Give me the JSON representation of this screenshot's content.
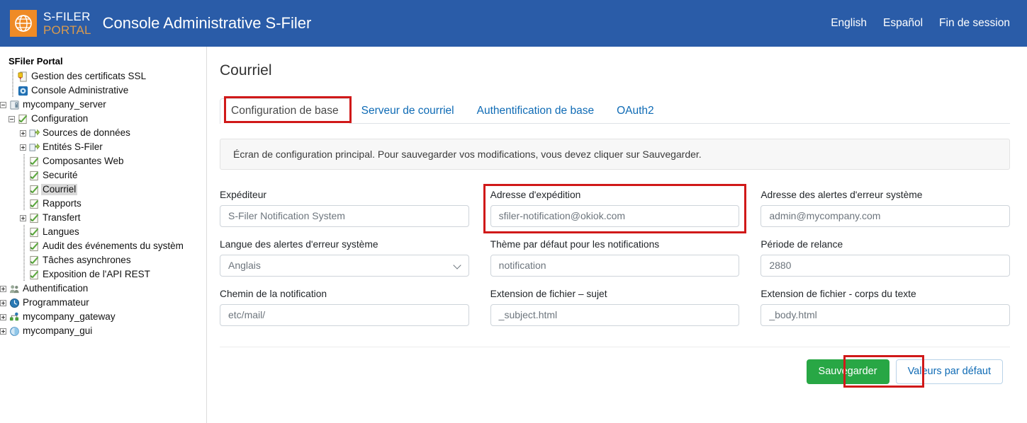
{
  "header": {
    "logo": {
      "icon": "globe-icon",
      "line1": "S-FILER",
      "line2": "PORTAL",
      "square_color": "#ef8b26"
    },
    "app_title": "Console Administrative S-Filer",
    "nav": [
      {
        "label": "English"
      },
      {
        "label": "Español"
      },
      {
        "label": "Fin de session"
      }
    ],
    "background_color": "#2a5ca8"
  },
  "sidebar": {
    "root_label": "SFiler Portal",
    "nodes": [
      {
        "label": "Gestion des certificats SSL",
        "indent": 1,
        "expander": "none",
        "icon": "certificate-icon",
        "selected": false
      },
      {
        "label": "Console Administrative",
        "indent": 1,
        "expander": "none",
        "icon": "gear-icon",
        "selected": false
      },
      {
        "label": "mycompany_server",
        "indent": 0,
        "expander": "minus",
        "icon": "server-icon",
        "selected": false
      },
      {
        "label": "Configuration",
        "indent": 1,
        "expander": "minus",
        "icon": "config-checklist-icon",
        "selected": false
      },
      {
        "label": "Sources de données",
        "indent": 2,
        "expander": "plus",
        "icon": "datasource-icon",
        "selected": false
      },
      {
        "label": "Entités S-Filer",
        "indent": 2,
        "expander": "plus",
        "icon": "entity-icon",
        "selected": false
      },
      {
        "label": "Composantes Web",
        "indent": 2,
        "expander": "none",
        "icon": "config-checklist-icon",
        "selected": false
      },
      {
        "label": "Securité",
        "indent": 2,
        "expander": "none",
        "icon": "config-checklist-icon",
        "selected": false
      },
      {
        "label": "Courriel",
        "indent": 2,
        "expander": "none",
        "icon": "config-checklist-icon",
        "selected": true
      },
      {
        "label": "Rapports",
        "indent": 2,
        "expander": "none",
        "icon": "config-checklist-icon",
        "selected": false
      },
      {
        "label": "Transfert",
        "indent": 2,
        "expander": "plus",
        "icon": "config-checklist-icon",
        "selected": false
      },
      {
        "label": "Langues",
        "indent": 2,
        "expander": "none",
        "icon": "config-checklist-icon",
        "selected": false
      },
      {
        "label": "Audit des événements du systèm",
        "indent": 2,
        "expander": "none",
        "icon": "config-checklist-icon",
        "selected": false
      },
      {
        "label": "Tâches asynchrones",
        "indent": 2,
        "expander": "none",
        "icon": "config-checklist-icon",
        "selected": false
      },
      {
        "label": "Exposition de l'API REST",
        "indent": 2,
        "expander": "none",
        "icon": "config-checklist-icon",
        "selected": false
      },
      {
        "label": "Authentification",
        "indent": 0,
        "expander": "plus",
        "icon": "users-icon",
        "selected": false
      },
      {
        "label": "Programmateur",
        "indent": 0,
        "expander": "plus",
        "icon": "clock-icon",
        "selected": false
      },
      {
        "label": "mycompany_gateway",
        "indent": 0,
        "expander": "plus",
        "icon": "gateway-icon",
        "selected": false
      },
      {
        "label": "mycompany_gui",
        "indent": 0,
        "expander": "plus",
        "icon": "gui-icon",
        "selected": false
      }
    ]
  },
  "main": {
    "page_title": "Courriel",
    "tabs": [
      {
        "label": "Configuration de base",
        "active": true
      },
      {
        "label": "Serveur de courriel",
        "active": false
      },
      {
        "label": "Authentification de base",
        "active": false
      },
      {
        "label": "OAuth2",
        "active": false
      }
    ],
    "info_banner": "Écran de configuration principal. Pour sauvegarder vos modifications, vous devez cliquer sur Sauvegarder.",
    "fields": [
      {
        "label": "Expéditeur",
        "value": "S-Filer Notification System",
        "type": "text",
        "highlighted": false
      },
      {
        "label": "Adresse d'expédition",
        "value": "sfiler-notification@okiok.com",
        "type": "text",
        "highlighted": true
      },
      {
        "label": "Adresse des alertes d'erreur système",
        "value": "admin@mycompany.com",
        "type": "text",
        "highlighted": false
      },
      {
        "label": "Langue des alertes d'erreur système",
        "value": "Anglais",
        "type": "select",
        "highlighted": false
      },
      {
        "label": "Thème par défaut pour les notifications",
        "value": "notification",
        "type": "text",
        "highlighted": false
      },
      {
        "label": "Période de relance",
        "value": "2880",
        "type": "text",
        "highlighted": false
      },
      {
        "label": "Chemin de la notification",
        "value": "etc/mail/",
        "type": "text",
        "highlighted": false
      },
      {
        "label": "Extension de fichier – sujet",
        "value": "_subject.html",
        "type": "text",
        "highlighted": false
      },
      {
        "label": "Extension de fichier - corps du texte",
        "value": "_body.html",
        "type": "text",
        "highlighted": false
      }
    ],
    "actions": {
      "save_label": "Sauvegarder",
      "defaults_label": "Valeurs par défaut",
      "save_color": "#28a745",
      "highlight_color": "#d01919"
    }
  }
}
